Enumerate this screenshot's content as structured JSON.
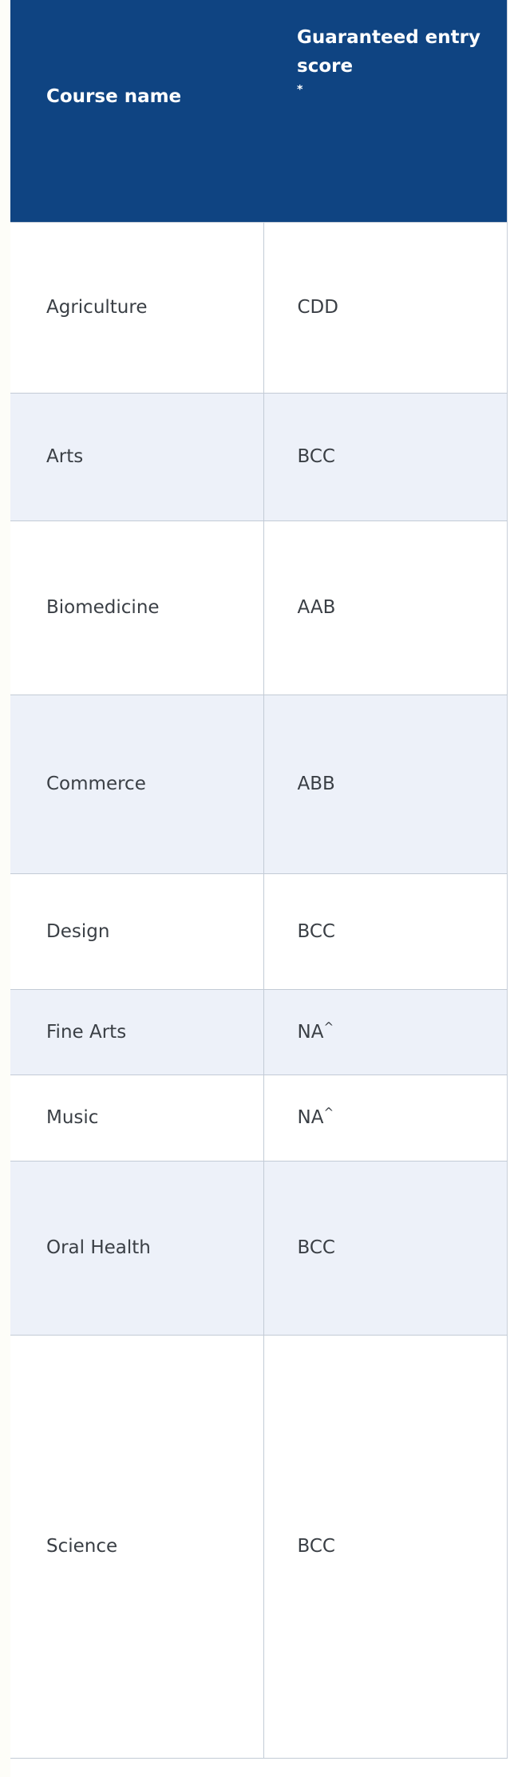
{
  "table": {
    "columns": [
      {
        "key": "course_name",
        "label": "Course name"
      },
      {
        "key": "guaranteed_entry_score",
        "label": "Guaranteed entry score",
        "marker": "*"
      }
    ],
    "header_background": "#0F4482",
    "header_text_color": "#FFFFFF",
    "stripe_background": "#EDF1F9",
    "row_background": "#FFFFFF",
    "border_color": "#C3CBD6",
    "body_text_color": "#3A3F45",
    "rows": [
      {
        "course_name": "Agriculture",
        "guaranteed_entry_score": "CDD",
        "marker": ""
      },
      {
        "course_name": "Arts",
        "guaranteed_entry_score": "BCC",
        "marker": ""
      },
      {
        "course_name": "Biomedicine",
        "guaranteed_entry_score": "AAB",
        "marker": ""
      },
      {
        "course_name": "Commerce",
        "guaranteed_entry_score": "ABB",
        "marker": ""
      },
      {
        "course_name": "Design",
        "guaranteed_entry_score": "BCC",
        "marker": ""
      },
      {
        "course_name": "Fine Arts",
        "guaranteed_entry_score": "NA",
        "marker": "^"
      },
      {
        "course_name": "Music",
        "guaranteed_entry_score": "NA",
        "marker": "^"
      },
      {
        "course_name": "Oral Health",
        "guaranteed_entry_score": "BCC",
        "marker": ""
      },
      {
        "course_name": "Science",
        "guaranteed_entry_score": "BCC",
        "marker": ""
      }
    ]
  }
}
